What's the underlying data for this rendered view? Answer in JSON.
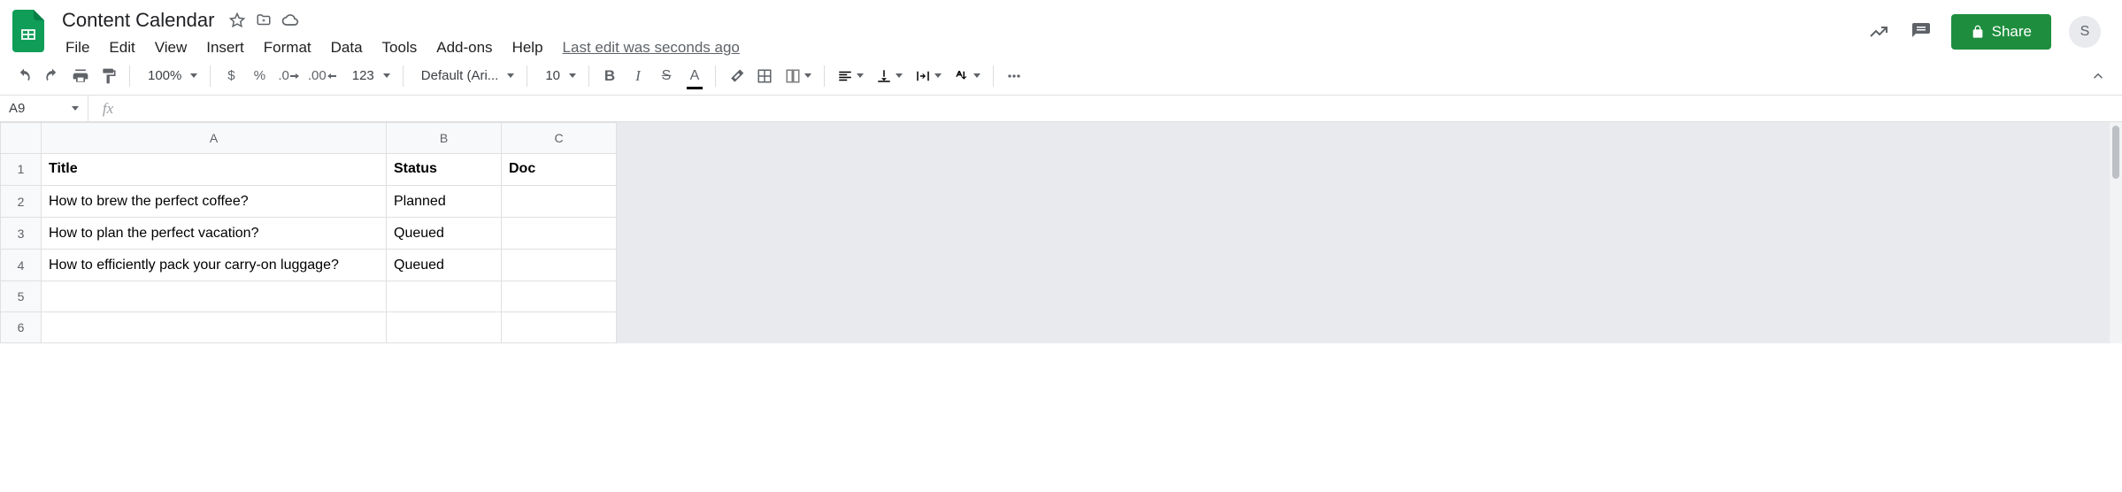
{
  "doc_title": "Content Calendar",
  "menus": [
    "File",
    "Edit",
    "View",
    "Insert",
    "Format",
    "Data",
    "Tools",
    "Add-ons",
    "Help"
  ],
  "last_edit": "Last edit was seconds ago",
  "share_label": "Share",
  "avatar_letter": "S",
  "toolbar": {
    "zoom": "100%",
    "currency": "$",
    "percent": "%",
    "dec_dec": ".0",
    "inc_dec": ".00",
    "more_fmt": "123",
    "font": "Default (Ari...",
    "font_size": "10"
  },
  "name_box": "A9",
  "fx": "fx",
  "columns": [
    "A",
    "B",
    "C"
  ],
  "rows": [
    {
      "n": "1",
      "a": "Title",
      "b": "Status",
      "c": "Doc",
      "bold": true
    },
    {
      "n": "2",
      "a": "How to brew the perfect coffee?",
      "b": "Planned",
      "c": ""
    },
    {
      "n": "3",
      "a": "How to plan the perfect vacation?",
      "b": "Queued",
      "c": ""
    },
    {
      "n": "4",
      "a": "How to efficiently pack your carry-on luggage?",
      "b": "Queued",
      "c": ""
    },
    {
      "n": "5",
      "a": "",
      "b": "",
      "c": ""
    },
    {
      "n": "6",
      "a": "",
      "b": "",
      "c": ""
    }
  ]
}
